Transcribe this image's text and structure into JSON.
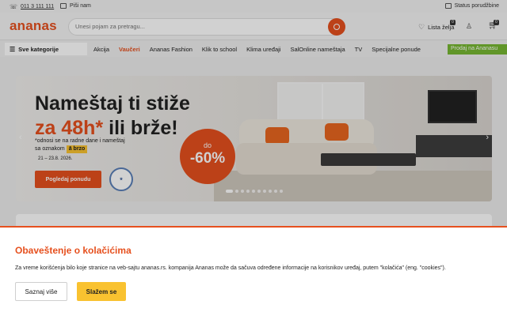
{
  "topbar": {
    "phone": "011 3 111 111",
    "write_us": "Piši nam",
    "order_status": "Status porudžbine"
  },
  "header": {
    "logo": "ananas",
    "search_placeholder": "Unesi pojam za pretragu...",
    "wishlist_label": "Lista želja",
    "wishlist_count": "0",
    "cart_count": "0"
  },
  "nav": {
    "categories": "Sve kategorije",
    "items": [
      "Akcija",
      "Vaučeri",
      "Ananas Fashion",
      "Klik to school",
      "Klima uređaji",
      "SalOnline nameštaja",
      "TV",
      "Specijalne ponude"
    ],
    "highlighted": "Vaučeri",
    "green_item": "Prodaj na Ananasu"
  },
  "banner": {
    "headline_1": "Nameštaj ti stiže",
    "headline_2_accent": "za 48h*",
    "headline_2_rest": " ili brže!",
    "sub_1": "*odnosi se na radne dane i nameštaj",
    "sub_2": "sa oznakom",
    "chip": "ā brzo",
    "dates": "21 – 23.8. 2026.",
    "cta": "Pogledaj ponudu",
    "discount_prefix": "do",
    "discount_value": "-60%",
    "slide_count": 10,
    "active_slide": 1
  },
  "cookie": {
    "title": "Obaveštenje o kolačićima",
    "text": "Za vreme korišćenja bilo koje stranice na veb-sajtu ananas.rs. kompanija Ananas može da sačuva određene informacije na korisnikov uređaj, putem \"kolačića\" (eng. \"cookies\").",
    "more_button": "Saznaj više",
    "accept_button": "Slažem se"
  },
  "colors": {
    "brand": "#e6501e",
    "accept": "#f9c230",
    "green": "#77b832"
  }
}
